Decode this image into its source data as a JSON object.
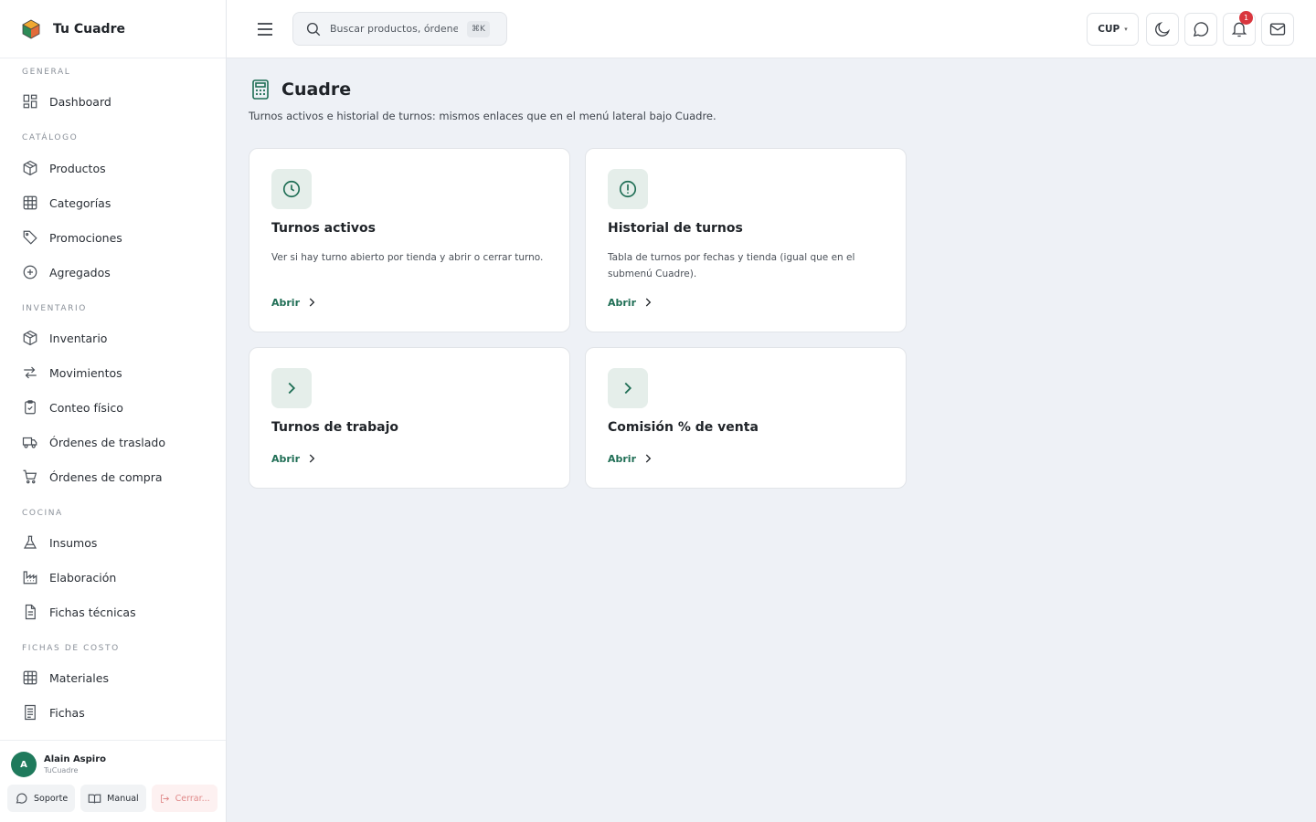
{
  "app": {
    "name": "Tu Cuadre"
  },
  "sidebar": {
    "sections": [
      {
        "title": "GENERAL",
        "items": [
          {
            "label": "Dashboard",
            "icon": "dashboard-icon"
          }
        ]
      },
      {
        "title": "CATÁLOGO",
        "items": [
          {
            "label": "Productos",
            "icon": "box-icon"
          },
          {
            "label": "Categorías",
            "icon": "grid-icon"
          },
          {
            "label": "Promociones",
            "icon": "tag-icon"
          },
          {
            "label": "Agregados",
            "icon": "plus-circle-icon"
          }
        ]
      },
      {
        "title": "INVENTARIO",
        "items": [
          {
            "label": "Inventario",
            "icon": "box-icon"
          },
          {
            "label": "Movimientos",
            "icon": "arrows-icon"
          },
          {
            "label": "Conteo físico",
            "icon": "clipboard-check-icon"
          },
          {
            "label": "Órdenes de traslado",
            "icon": "truck-icon"
          },
          {
            "label": "Órdenes de compra",
            "icon": "cart-icon"
          }
        ]
      },
      {
        "title": "COCINA",
        "items": [
          {
            "label": "Insumos",
            "icon": "flask-icon"
          },
          {
            "label": "Elaboración",
            "icon": "factory-icon"
          },
          {
            "label": "Fichas técnicas",
            "icon": "document-icon"
          }
        ]
      },
      {
        "title": "FICHAS DE COSTO",
        "items": [
          {
            "label": "Materiales",
            "icon": "grid-icon"
          },
          {
            "label": "Fichas",
            "icon": "document-icon"
          }
        ]
      }
    ]
  },
  "user": {
    "initial": "A",
    "name": "Alain Aspiro",
    "org": "TuCuadre",
    "support_label": "Soporte",
    "manual_label": "Manual",
    "logout_label": "Cerrar..."
  },
  "header": {
    "search_placeholder": "Buscar productos, órdenes...",
    "shortcut": "⌘K",
    "currency": "CUP",
    "notification_count": "1"
  },
  "page": {
    "title": "Cuadre",
    "subtitle": "Turnos activos e historial de turnos: mismos enlaces que en el menú lateral bajo Cuadre."
  },
  "cards": [
    {
      "title": "Turnos activos",
      "description": "Ver si hay turno abierto por tienda y abrir o cerrar turno.",
      "link": "Abrir",
      "icon": "clock-icon"
    },
    {
      "title": "Historial de turnos",
      "description": "Tabla de turnos por fechas y tienda (igual que en el submenú Cuadre).",
      "link": "Abrir",
      "icon": "alert-circle-icon"
    },
    {
      "title": "Turnos de trabajo",
      "description": "",
      "link": "Abrir",
      "icon": "chevron-right-icon"
    },
    {
      "title": "Comisión % de venta",
      "description": "",
      "link": "Abrir",
      "icon": "chevron-right-icon"
    }
  ],
  "colors": {
    "accent": "#1f6e55",
    "accent_bg": "#e5eeea",
    "badge": "#d9363e"
  }
}
